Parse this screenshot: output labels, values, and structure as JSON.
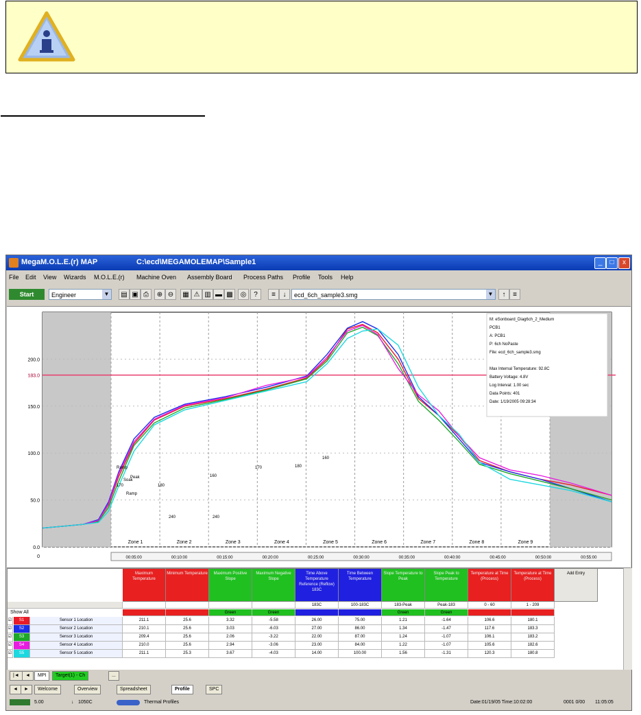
{
  "window": {
    "app_title": "MegaM.O.L.E.(r) MAP",
    "file_path": "C:\\ecd\\MEGAMOLEMAP\\Sample1",
    "controls": {
      "minimize": "_",
      "maximize": "□",
      "close": "x"
    }
  },
  "menu": [
    "File",
    "Edit",
    "View",
    "Wizards",
    "M.O.L.E.(r)",
    "Machine Oven",
    "Assembly Board",
    "Process Paths",
    "Profile",
    "Tools",
    "Help"
  ],
  "toolbar": {
    "start_label": "Start",
    "mode_value": "Engineer",
    "profile_file": "ecd_6ch_sample3.smg"
  },
  "chart_data": {
    "type": "line",
    "ylim": [
      0,
      250
    ],
    "y_ticks": [
      {
        "value": 200.0,
        "label": "200.0"
      },
      {
        "value": 150.0,
        "label": "150.0"
      },
      {
        "value": 183.0,
        "label": "183.0"
      },
      {
        "value": 100.0,
        "label": "100.0"
      },
      {
        "value": 50.0,
        "label": "50.0"
      },
      {
        "value": 0.0,
        "label": "0.0"
      }
    ],
    "reference_line": {
      "value": 183.0,
      "label": "183.0",
      "color": "#e83c6e"
    },
    "zones": [
      "Zone 1",
      "Zone 2",
      "Zone 3",
      "Zone 4",
      "Zone 5",
      "Zone 6",
      "Zone 7",
      "Zone 8",
      "Zone 9"
    ],
    "x_start_label": "0",
    "x_ticks": [
      "00:05:00",
      "00:10:00",
      "00:15:00",
      "00:20:00",
      "00:25:00",
      "00:30:00",
      "00:35:00",
      "00:40:00",
      "00:45:00",
      "00:50:00",
      "00:55:00"
    ],
    "annotations": [
      "Ramp",
      "Soak",
      "Ramp",
      "Peak",
      "240",
      "240",
      "170",
      "180",
      "160",
      "170",
      "180",
      "160"
    ],
    "legend_box": [
      "M: eSonboard_Diag6ch_2_Medium",
      "PCB1",
      "A: PCB1",
      "P: 6ch NoPaste",
      "File: ecd_6ch_sample3.smg",
      "Max Internal Temperature: 92.8C",
      "Battery Voltage: 4.8V",
      "Log Interval: 1.00 sec",
      "Data Points: 401",
      "Date: 1/19/2005 09:28:34"
    ],
    "series": [
      {
        "name": "Sensor 1 Location",
        "color": "#e81c28",
        "values": [
          [
            0,
            20
          ],
          [
            20,
            22
          ],
          [
            40,
            24
          ],
          [
            55,
            28
          ],
          [
            65,
            45
          ],
          [
            75,
            75
          ],
          [
            90,
            110
          ],
          [
            110,
            135
          ],
          [
            140,
            150
          ],
          [
            180,
            158
          ],
          [
            220,
            168
          ],
          [
            260,
            180
          ],
          [
            280,
            200
          ],
          [
            300,
            232
          ],
          [
            315,
            237
          ],
          [
            330,
            228
          ],
          [
            350,
            200
          ],
          [
            370,
            158
          ],
          [
            390,
            140
          ],
          [
            410,
            118
          ],
          [
            430,
            92
          ],
          [
            460,
            80
          ],
          [
            490,
            72
          ],
          [
            520,
            66
          ],
          [
            560,
            55
          ]
        ]
      },
      {
        "name": "Sensor 2 Location",
        "color": "#1c2ee8",
        "values": [
          [
            0,
            20
          ],
          [
            20,
            22
          ],
          [
            40,
            24
          ],
          [
            55,
            29
          ],
          [
            65,
            48
          ],
          [
            75,
            80
          ],
          [
            90,
            115
          ],
          [
            110,
            138
          ],
          [
            140,
            152
          ],
          [
            180,
            160
          ],
          [
            220,
            170
          ],
          [
            260,
            182
          ],
          [
            280,
            205
          ],
          [
            300,
            233
          ],
          [
            315,
            240
          ],
          [
            330,
            232
          ],
          [
            350,
            205
          ],
          [
            370,
            160
          ],
          [
            390,
            140
          ],
          [
            410,
            115
          ],
          [
            430,
            90
          ],
          [
            460,
            80
          ],
          [
            490,
            72
          ],
          [
            520,
            62
          ],
          [
            560,
            48
          ]
        ]
      },
      {
        "name": "Sensor 3 Location",
        "color": "#1ca828",
        "values": [
          [
            0,
            20
          ],
          [
            20,
            22
          ],
          [
            40,
            24
          ],
          [
            55,
            27
          ],
          [
            65,
            42
          ],
          [
            75,
            70
          ],
          [
            90,
            108
          ],
          [
            110,
            132
          ],
          [
            140,
            148
          ],
          [
            180,
            157
          ],
          [
            220,
            167
          ],
          [
            260,
            179
          ],
          [
            280,
            198
          ],
          [
            300,
            228
          ],
          [
            315,
            234
          ],
          [
            330,
            225
          ],
          [
            350,
            195
          ],
          [
            370,
            155
          ],
          [
            390,
            135
          ],
          [
            410,
            112
          ],
          [
            430,
            88
          ],
          [
            460,
            78
          ],
          [
            490,
            70
          ],
          [
            520,
            62
          ],
          [
            560,
            50
          ]
        ]
      },
      {
        "name": "Sensor 4 Location",
        "color": "#e81ce0",
        "values": [
          [
            0,
            20
          ],
          [
            20,
            22
          ],
          [
            40,
            24
          ],
          [
            55,
            28
          ],
          [
            65,
            46
          ],
          [
            75,
            78
          ],
          [
            90,
            112
          ],
          [
            110,
            136
          ],
          [
            140,
            151
          ],
          [
            180,
            159
          ],
          [
            220,
            172
          ],
          [
            260,
            181
          ],
          [
            280,
            202
          ],
          [
            300,
            230
          ],
          [
            315,
            236
          ],
          [
            330,
            226
          ],
          [
            350,
            190
          ],
          [
            370,
            162
          ],
          [
            390,
            145
          ],
          [
            410,
            118
          ],
          [
            430,
            95
          ],
          [
            460,
            82
          ],
          [
            490,
            76
          ],
          [
            520,
            68
          ],
          [
            560,
            55
          ]
        ]
      },
      {
        "name": "Sensor 5 Location",
        "color": "#1cd8e0",
        "values": [
          [
            0,
            20
          ],
          [
            20,
            22
          ],
          [
            40,
            24
          ],
          [
            55,
            26
          ],
          [
            65,
            38
          ],
          [
            75,
            65
          ],
          [
            90,
            102
          ],
          [
            110,
            130
          ],
          [
            140,
            146
          ],
          [
            180,
            156
          ],
          [
            220,
            166
          ],
          [
            260,
            176
          ],
          [
            280,
            195
          ],
          [
            300,
            222
          ],
          [
            315,
            230
          ],
          [
            330,
            232
          ],
          [
            350,
            215
          ],
          [
            370,
            170
          ],
          [
            390,
            140
          ],
          [
            410,
            120
          ],
          [
            430,
            90
          ],
          [
            460,
            72
          ],
          [
            490,
            66
          ],
          [
            520,
            60
          ],
          [
            560,
            48
          ]
        ]
      }
    ]
  },
  "grid": {
    "headers": [
      {
        "label": "Maximum Temperature",
        "color": "#e82020"
      },
      {
        "label": "Minimum Temperature",
        "color": "#e82020"
      },
      {
        "label": "Maximum Positive Slope",
        "color": "#20c020"
      },
      {
        "label": "Maximum Negative Slope",
        "color": "#20c020"
      },
      {
        "label": "Time Above Temperature Reference (Reflow) 183C",
        "color": "#2020e0"
      },
      {
        "label": "Time Between Temperature",
        "color": "#2020e0"
      },
      {
        "label": "Slope Temperature to Peak",
        "color": "#20c020"
      },
      {
        "label": "Slope Peak to Temperature",
        "color": "#20c020"
      },
      {
        "label": "Temperature at Time (Process)",
        "color": "#e82020"
      },
      {
        "label": "Temperature at Time (Process)",
        "color": "#e82020"
      },
      {
        "label": "Add Entry",
        "color": "#e8e6e0"
      }
    ],
    "spec_row": [
      "",
      "",
      "",
      "",
      "183C",
      "100-183C",
      "183-Peak",
      "Peak-183",
      "0 - 60",
      "1 - 209"
    ],
    "status_row": [
      "",
      "",
      "Green",
      "Green",
      "",
      "",
      "Green",
      "Green",
      "",
      ""
    ],
    "show_all_label": "Show All",
    "rows": [
      {
        "id": "S1",
        "color": "#e81c28",
        "name": "Sensor 1 Location",
        "values": [
          "211.1",
          "25.6",
          "3.32",
          "-5.58",
          "26.00",
          "75.00",
          "1.21",
          "-1.64",
          "106.6",
          "180.1"
        ]
      },
      {
        "id": "S2",
        "color": "#1c2ee8",
        "name": "Sensor 2 Location",
        "values": [
          "210.1",
          "25.6",
          "3.03",
          "-6.03",
          "27.00",
          "86.00",
          "1.34",
          "-1.47",
          "117.6",
          "183.3"
        ]
      },
      {
        "id": "S3",
        "color": "#1ca828",
        "name": "Sensor 3 Location",
        "values": [
          "209.4",
          "25.6",
          "2.06",
          "-3.22",
          "22.00",
          "87.00",
          "1.24",
          "-1.07",
          "106.1",
          "183.2"
        ]
      },
      {
        "id": "S4",
        "color": "#e81ce0",
        "name": "Sensor 4 Location",
        "values": [
          "210.0",
          "25.6",
          "2.94",
          "-3.06",
          "23.00",
          "84.00",
          "1.22",
          "-1.07",
          "105.6",
          "182.6"
        ]
      },
      {
        "id": "S5",
        "color": "#1cd8e0",
        "name": "Sensor 5 Location",
        "values": [
          "211.1",
          "25.3",
          "3.67",
          "-4.03",
          "14.00",
          "100.00",
          "1.56",
          "-1.31",
          "120.3",
          "180.8"
        ]
      }
    ]
  },
  "sheet_tabs": [
    "MPI",
    "Target(1) - Ch",
    "..."
  ],
  "view_tabs": [
    "Welcome",
    "Overview",
    "Spreadsheet",
    "Profile",
    "SPC"
  ],
  "status_bar": {
    "left_value": "5.00",
    "temp_value": "1050C",
    "mode": "Thermal Profiles",
    "date_time": "Date:01/19/05 Time:10:02:00",
    "right_a": "0001 0/00",
    "right_b": "11:05:05"
  }
}
